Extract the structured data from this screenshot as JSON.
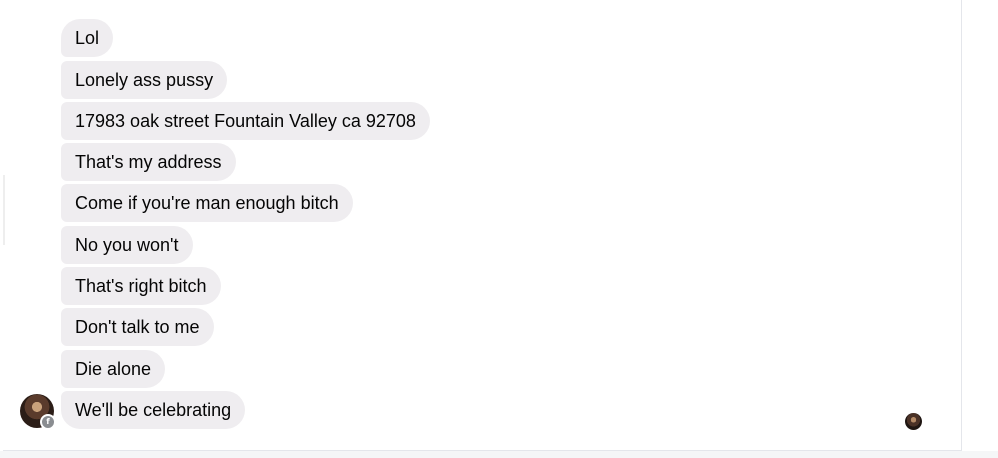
{
  "conversation": {
    "messages": [
      "Lol",
      "Lonely ass pussy",
      "17983 oak street Fountain Valley ca 92708",
      "That's my address",
      "Come if you're man enough bitch",
      "No you won't",
      "That's right bitch",
      "Don't talk to me",
      "Die alone",
      "We'll be celebrating"
    ],
    "bubble_color": "#efedf0",
    "text_color": "#050505",
    "sender_avatar_icon": "profile-photo",
    "sender_badge_icon": "facebook-f-icon",
    "sender_badge_glyph": "f",
    "seen_indicator_icon": "seen-avatar"
  }
}
